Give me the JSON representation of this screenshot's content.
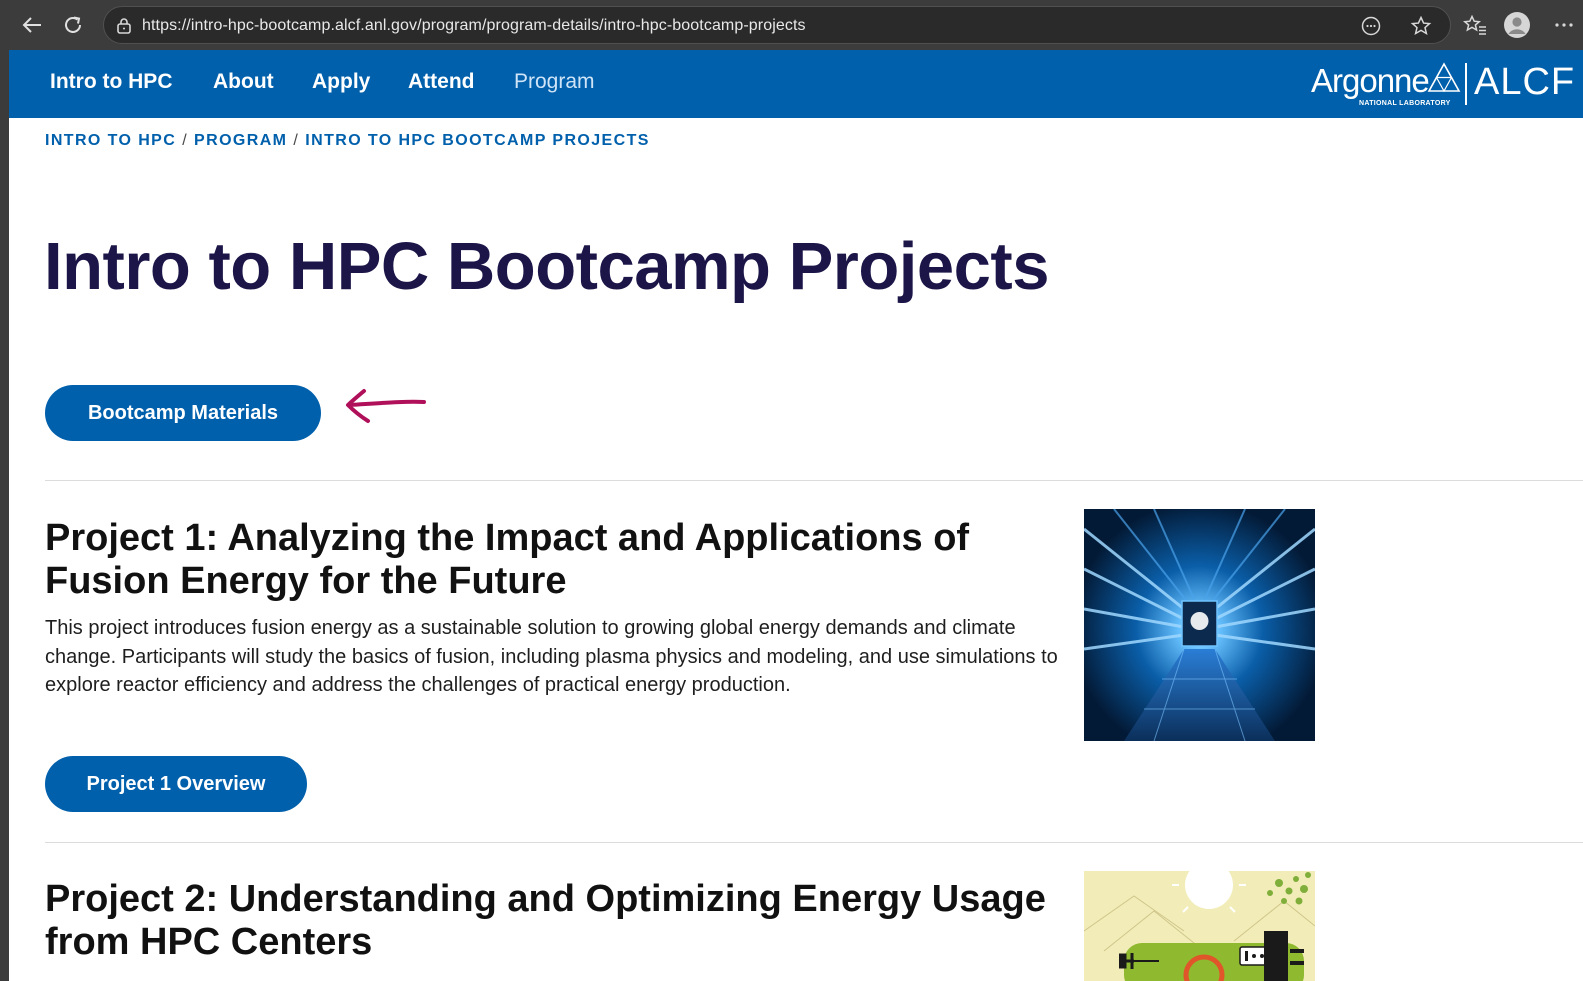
{
  "browser": {
    "url": "https://intro-hpc-bootcamp.alcf.anl.gov/program/program-details/intro-hpc-bootcamp-projects"
  },
  "nav": {
    "items": [
      "Intro to HPC",
      "About",
      "Apply",
      "Attend",
      "Program"
    ],
    "active": "Program",
    "logo_argonne": "Argonne",
    "logo_argonne_sub": "NATIONAL LABORATORY",
    "logo_alcf": "ALCF"
  },
  "breadcrumb": [
    "INTRO TO HPC",
    "PROGRAM",
    "INTRO TO HPC BOOTCAMP PROJECTS"
  ],
  "page": {
    "title": "Intro to HPC Bootcamp Projects",
    "materials_button": "Bootcamp Materials"
  },
  "projects": [
    {
      "title": "Project 1: Analyzing the Impact and Applications of Fusion Energy for the Future",
      "description": "This project introduces fusion energy as a sustainable solution to growing global energy demands and climate change. Participants will study the basics of fusion, including plasma physics and modeling, and use simulations to explore reactor efficiency and address the challenges of practical energy production.",
      "button": "Project 1 Overview"
    },
    {
      "title": "Project 2: Understanding and Optimizing Energy Usage from HPC Centers"
    }
  ],
  "colors": {
    "brand_blue": "#0060ac",
    "title_navy": "#1b1548",
    "annotation_arrow": "#b0105a"
  }
}
